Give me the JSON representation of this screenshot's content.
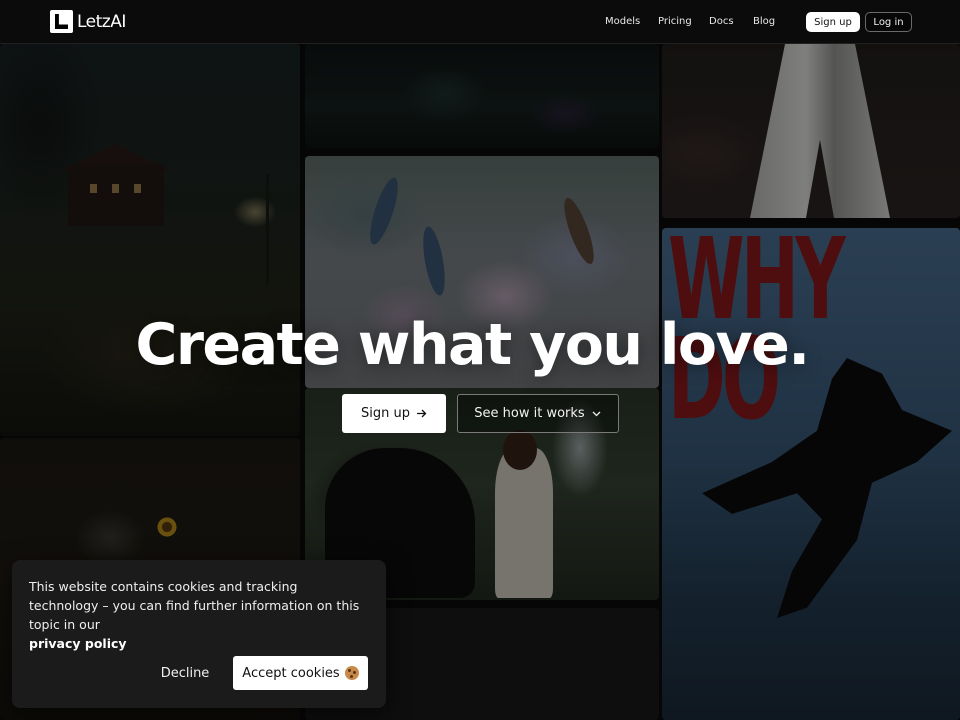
{
  "header": {
    "logo_text": "LetzAI",
    "nav": [
      {
        "label": "Models"
      },
      {
        "label": "Pricing"
      },
      {
        "label": "Docs"
      },
      {
        "label": "Blog"
      }
    ],
    "signup_label": "Sign up",
    "login_label": "Log in"
  },
  "hero": {
    "title": "Create what you love.",
    "primary_cta": "Sign up",
    "secondary_cta": "See how it works"
  },
  "background": {
    "poster_text": "WHY DO"
  },
  "cookie_banner": {
    "text": "This website contains cookies and tracking technology – you can find further information on this topic in our",
    "link_label": "privacy policy",
    "decline_label": "Decline",
    "accept_label": "Accept cookies"
  },
  "icons": {
    "primary_cta_icon": "arrow-right-icon",
    "secondary_cta_icon": "chevron-down-icon",
    "accept_icon": "cookie-icon"
  },
  "colors": {
    "header_bg": "#0c0c0c",
    "button_primary_bg": "#ffffff",
    "cookie_banner_bg": "#1b1b1b"
  }
}
